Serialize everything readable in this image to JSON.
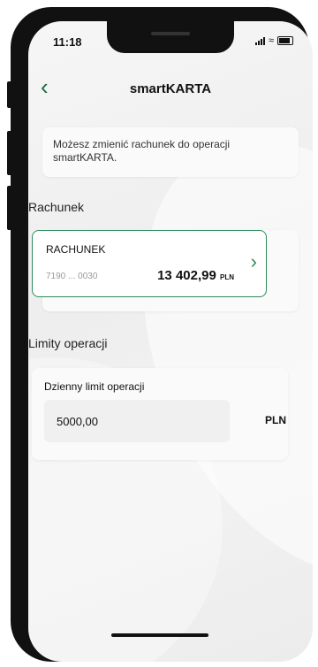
{
  "status": {
    "time": "11:18"
  },
  "header": {
    "title": "smartKARTA"
  },
  "info": {
    "text": "Możesz zmienić rachunek do operacji smartKARTA."
  },
  "sections": {
    "account_label": "Rachunek",
    "limits_label": "Limity operacji"
  },
  "account": {
    "name": "RACHUNEK",
    "number": "7190 ... 0030",
    "balance": "13 402,99",
    "currency": "PLN"
  },
  "limit": {
    "title": "Dzienny limit operacji",
    "value": "5000,00",
    "currency": "PLN"
  },
  "colors": {
    "accent": "#2e8a5a",
    "back_icon": "#1a6b3f"
  },
  "icons": [
    "back-arrow-icon",
    "chevron-right-icon",
    "signal-icon",
    "wifi-icon",
    "battery-icon"
  ]
}
